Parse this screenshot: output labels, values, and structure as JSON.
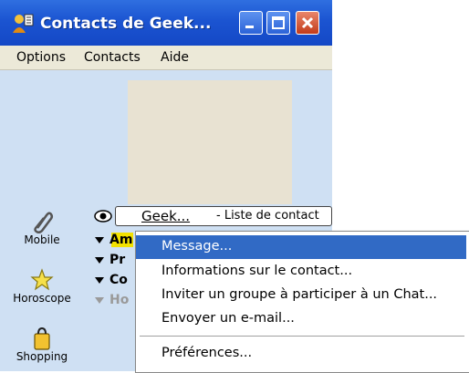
{
  "window": {
    "title": "Contacts de Geek..."
  },
  "menubar": [
    "Options",
    "Contacts",
    "Aide"
  ],
  "sidebar": [
    {
      "label": "Mobile",
      "icon": "paperclip-icon"
    },
    {
      "label": "Horoscope",
      "icon": "star-icon"
    },
    {
      "label": "Shopping",
      "icon": "shopping-bag-icon"
    }
  ],
  "list": {
    "user_name": "Geek...",
    "list_title": "- Liste de contact",
    "groups": [
      "Am",
      "Pr",
      "Co",
      "Ho"
    ]
  },
  "context_menu": [
    "Message...",
    "Informations sur le contact...",
    "Inviter un groupe à participer à un Chat...",
    "Envoyer un e-mail...",
    "Préférences..."
  ],
  "colors": {
    "titlebar": "#1b54d1",
    "menu_highlight": "#316ac5",
    "group_highlight": "#f2e100"
  }
}
